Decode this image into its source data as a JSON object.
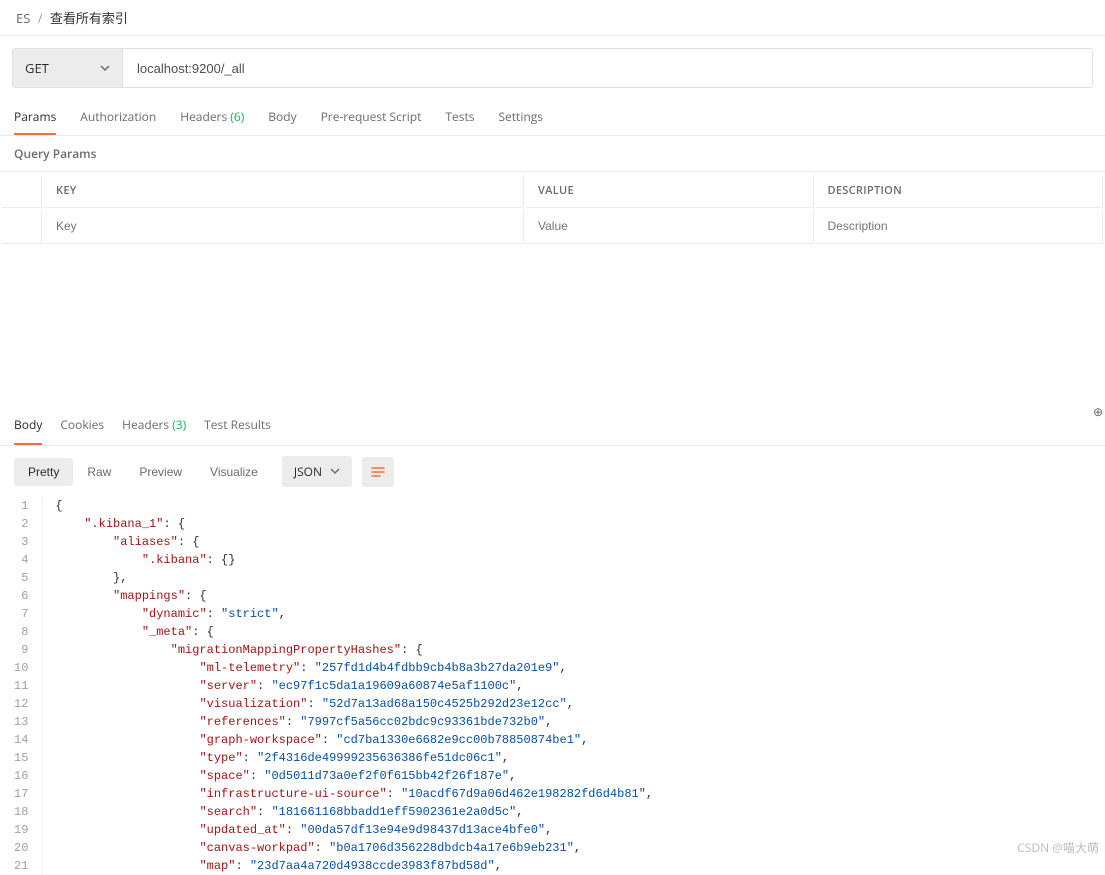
{
  "breadcrumb": {
    "root": "ES",
    "sep": "/",
    "current": "查看所有索引"
  },
  "request": {
    "method": "GET",
    "url": "localhost:9200/_all"
  },
  "reqTabs": {
    "items": [
      "Params",
      "Authorization",
      "Headers",
      "Body",
      "Pre-request Script",
      "Tests",
      "Settings"
    ],
    "active": 0,
    "headersCount": "(6)"
  },
  "subheader": "Query Params",
  "paramsHeaders": {
    "key": "KEY",
    "value": "VALUE",
    "desc": "DESCRIPTION"
  },
  "paramsPlaceholders": {
    "key": "Key",
    "value": "Value",
    "desc": "Description"
  },
  "respTabs": {
    "items": [
      "Body",
      "Cookies",
      "Headers",
      "Test Results"
    ],
    "active": 0,
    "headersCount": "(3)"
  },
  "viewModes": {
    "items": [
      "Pretty",
      "Raw",
      "Preview",
      "Visualize"
    ],
    "active": 0
  },
  "format": "JSON",
  "code": {
    "lines": [
      "{",
      "    \".kibana_1\": {",
      "        \"aliases\": {",
      "            \".kibana\": {}",
      "        },",
      "        \"mappings\": {",
      "            \"dynamic\": \"strict\",",
      "            \"_meta\": {",
      "                \"migrationMappingPropertyHashes\": {",
      "                    \"ml-telemetry\": \"257fd1d4b4fdbb9cb4b8a3b27da201e9\",",
      "                    \"server\": \"ec97f1c5da1a19609a60874e5af1100c\",",
      "                    \"visualization\": \"52d7a13ad68a150c4525b292d23e12cc\",",
      "                    \"references\": \"7997cf5a56cc02bdc9c93361bde732b0\",",
      "                    \"graph-workspace\": \"cd7ba1330e6682e9cc00b78850874be1\",",
      "                    \"type\": \"2f4316de49999235636386fe51dc06c1\",",
      "                    \"space\": \"0d5011d73a0ef2f0f615bb42f26f187e\",",
      "                    \"infrastructure-ui-source\": \"10acdf67d9a06d462e198282fd6d4b81\",",
      "                    \"search\": \"181661168bbadd1eff5902361e2a0d5c\",",
      "                    \"updated_at\": \"00da57df13e94e9d98437d13ace4bfe0\",",
      "                    \"canvas-workpad\": \"b0a1706d356228dbdcb4a17e6b9eb231\",",
      "                    \"map\": \"23d7aa4a720d4938ccde3983f87bd58d\","
    ]
  },
  "watermark": "CSDN @喵大萌"
}
